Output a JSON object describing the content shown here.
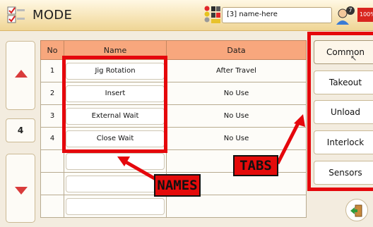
{
  "header": {
    "title": "MODE",
    "program_name": "[3] name-here",
    "user_level": "7",
    "battery_label": "100%"
  },
  "nav": {
    "page_number": "4"
  },
  "table": {
    "columns": [
      "No",
      "Name",
      "Data"
    ],
    "rows": [
      {
        "no": "1",
        "name": "Jig Rotation",
        "data": "After Travel"
      },
      {
        "no": "2",
        "name": "Insert",
        "data": "No Use"
      },
      {
        "no": "3",
        "name": "External Wait",
        "data": "No Use"
      },
      {
        "no": "4",
        "name": "Close Wait",
        "data": "No Use"
      },
      {
        "no": "",
        "name": "",
        "data": ""
      },
      {
        "no": "",
        "name": "",
        "data": ""
      },
      {
        "no": "",
        "name": "",
        "data": ""
      }
    ]
  },
  "tabs": [
    "Common",
    "Takeout",
    "Unload",
    "Interlock",
    "Sensors"
  ],
  "annotations": {
    "names_label": "NAMES",
    "tabs_label": "TABS",
    "color": "#e5070c"
  },
  "colors": {
    "header_bg": "#f7e5b8",
    "table_header_bg": "#f8a77d",
    "arrow_red": "#d93b3b"
  }
}
